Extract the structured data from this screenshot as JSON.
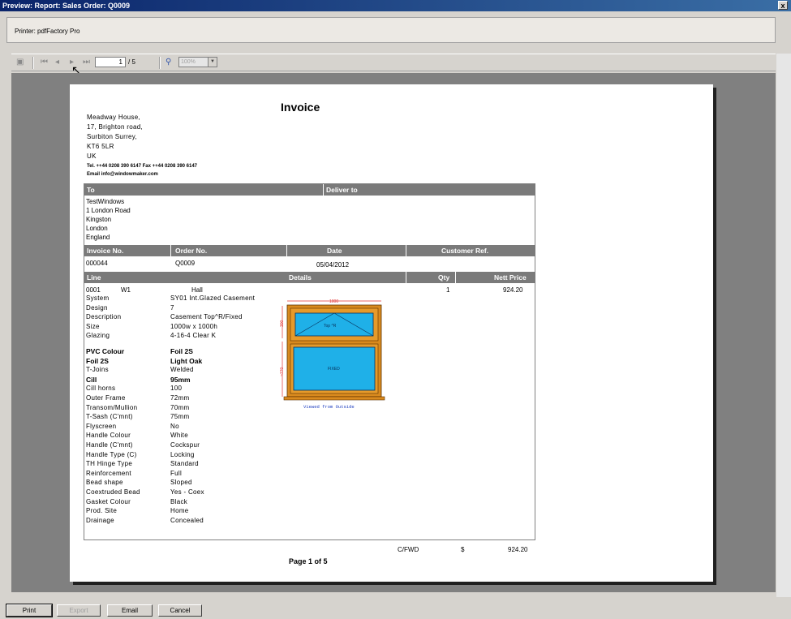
{
  "window": {
    "title": "Preview: Report: Sales Order: Q0009",
    "close_label": "x"
  },
  "printer": {
    "label": "Printer: pdfFactory Pro"
  },
  "toolbar": {
    "page_current": "1",
    "page_total": "/ 5",
    "zoom": "100%"
  },
  "invoice": {
    "title": "Invoice",
    "sender_address": [
      "Meadway House,",
      "17, Brighton road,",
      "Surbiton Surrey,",
      "KT6 5LR",
      "UK"
    ],
    "contact_tel": "Tel. ++44 0208 390 6147  Fax ++44 0208 390 6147",
    "contact_email": "Email info@windowmaker.com",
    "to_header": "To",
    "deliver_header": "Deliver to",
    "to_address": [
      "TestWindows",
      "1 London Road",
      "Kingston",
      "London",
      "England"
    ],
    "meta_headers": {
      "invoice_no": "Invoice No.",
      "order_no": "Order No.",
      "date": "Date",
      "customer_ref": "Customer Ref."
    },
    "meta_values": {
      "invoice_no": "000044",
      "order_no": "Q0009",
      "date": "05/04/2012",
      "customer_ref": ""
    },
    "line_headers": {
      "line": "Line",
      "details": "Details",
      "qty": "Qty",
      "nett_price": "Nett Price"
    },
    "line": {
      "number": "0001",
      "code": "W1",
      "location": "Hall",
      "qty": "1",
      "price": "924.20"
    },
    "details": [
      {
        "label": "System",
        "value": "SY01  Int.Glazed Casement",
        "bold": false
      },
      {
        "label": "Design",
        "value": "7",
        "bold": false
      },
      {
        "label": "Description",
        "value": "Casement Top^R/Fixed",
        "bold": false
      },
      {
        "label": "Size",
        "value": "1000w x 1000h",
        "bold": false
      },
      {
        "label": "Glazing",
        "value": "4-16-4 Clear K",
        "bold": false
      },
      {
        "label": "PVC Colour",
        "value": "Foil 2S",
        "bold": true
      },
      {
        "label": "Foil 2S",
        "value": "Light Oak",
        "bold": true
      },
      {
        "label": "T-Joins",
        "value": "Welded",
        "bold": false
      },
      {
        "label": "Cill",
        "value": "95mm",
        "bold": true
      },
      {
        "label": "Cill horns",
        "value": "100",
        "bold": false
      },
      {
        "label": "Outer Frame",
        "value": "72mm",
        "bold": false
      },
      {
        "label": "Transom/Mullion",
        "value": "70mm",
        "bold": false
      },
      {
        "label": "T-Sash (C'mnt)",
        "value": "75mm",
        "bold": false
      },
      {
        "label": "Flyscreen",
        "value": "No",
        "bold": false
      },
      {
        "label": "Handle Colour",
        "value": "White",
        "bold": false
      },
      {
        "label": "Handle (C'mnt)",
        "value": "Cockspur",
        "bold": false
      },
      {
        "label": "Handle Type (C)",
        "value": "Locking",
        "bold": false
      },
      {
        "label": "TH Hinge Type",
        "value": "Standard",
        "bold": false
      },
      {
        "label": "Reinforcement",
        "value": "Full",
        "bold": false
      },
      {
        "label": "Bead shape",
        "value": "Sloped",
        "bold": false
      },
      {
        "label": "Coextruded Bead",
        "value": "Yes - Coex",
        "bold": false
      },
      {
        "label": "Gasket Colour",
        "value": "Black",
        "bold": false
      },
      {
        "label": "Prod. Site",
        "value": "Home",
        "bold": false
      },
      {
        "label": "Drainage",
        "value": "Concealed",
        "bold": false
      }
    ],
    "drawing": {
      "width_label": "1000",
      "height_top": "300",
      "height_bottom": "~770",
      "top_pane": "Top ^R",
      "bottom_pane": "FIXED",
      "caption": "Viewed from Outside"
    },
    "footer": {
      "cfwd": "C/FWD",
      "currency": "$",
      "total": "924.20",
      "page": "Page 1 of 5"
    }
  },
  "buttons": {
    "print": "Print",
    "export": "Export",
    "email": "Email",
    "cancel": "Cancel"
  },
  "colors": {
    "header_gray": "#7a7a7a",
    "frame_orange": "#d98a1e",
    "glass_blue": "#1fb0e8"
  }
}
